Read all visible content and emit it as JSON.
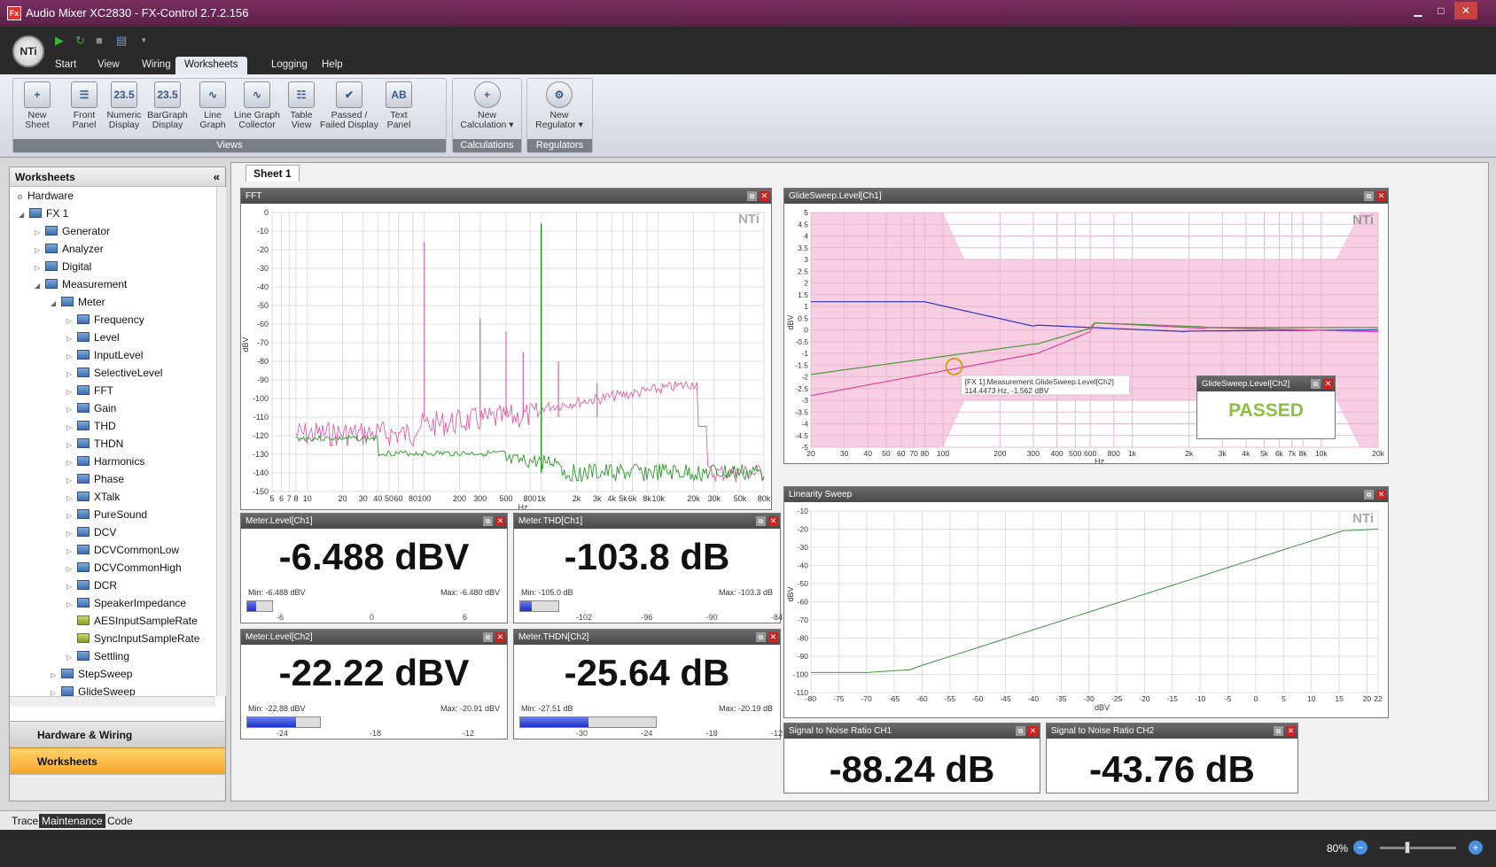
{
  "window": {
    "title": "Audio Mixer XC2830 - FX-Control 2.7.2.156",
    "icon": "Fx",
    "minimize": "▁",
    "maximize": "□",
    "close": "✕"
  },
  "logo": "NTi",
  "quick_access": [
    "play-icon",
    "refresh-icon",
    "stop-icon",
    "list-icon",
    "dropdown-icon"
  ],
  "menu_tabs": [
    {
      "label": "Start"
    },
    {
      "label": "View"
    },
    {
      "label": "Wiring"
    },
    {
      "label": "Worksheets",
      "active": true
    },
    {
      "label": "Logging"
    },
    {
      "label": "Help"
    }
  ],
  "ribbon": {
    "views": {
      "label": "Views",
      "buttons": [
        {
          "l1": "New",
          "l2": "Sheet",
          "icon": "new-sheet-icon",
          "glyph": "+"
        },
        {
          "l1": "Front",
          "l2": "Panel",
          "icon": "front-panel-icon",
          "glyph": "☰"
        },
        {
          "l1": "Numeric",
          "l2": "Display",
          "icon": "numeric-display-icon",
          "glyph": "23.5"
        },
        {
          "l1": "BarGraph",
          "l2": "Display",
          "icon": "bargraph-display-icon",
          "glyph": "23.5"
        },
        {
          "l1": "Line",
          "l2": "Graph",
          "icon": "line-graph-icon",
          "glyph": "∿"
        },
        {
          "l1": "Line Graph",
          "l2": "Collector",
          "icon": "line-graph-collector-icon",
          "glyph": "∿"
        },
        {
          "l1": "Table",
          "l2": "View",
          "icon": "table-view-icon",
          "glyph": "☷"
        },
        {
          "l1": "Passed /",
          "l2": "Failed Display",
          "icon": "passed-failed-icon",
          "glyph": "✔"
        },
        {
          "l1": "Text",
          "l2": "Panel",
          "icon": "text-panel-icon",
          "glyph": "AB"
        }
      ]
    },
    "calculations": {
      "label": "Calculations",
      "buttons": [
        {
          "l1": "New",
          "l2": "Calculation ▾",
          "icon": "new-calculation-icon",
          "glyph": "+"
        }
      ]
    },
    "regulators": {
      "label": "Regulators",
      "buttons": [
        {
          "l1": "New",
          "l2": "Regulator ▾",
          "icon": "new-regulator-icon",
          "glyph": "⚙"
        }
      ]
    }
  },
  "sidebar": {
    "title": "Worksheets",
    "collapse": "«",
    "tree": [
      {
        "label": "Hardware",
        "level": 0,
        "exp": "⊘"
      },
      {
        "label": "FX 1",
        "level": 1,
        "exp": "◢"
      },
      {
        "label": "Generator",
        "level": 2,
        "exp": "▷"
      },
      {
        "label": "Analyzer",
        "level": 2,
        "exp": "▷"
      },
      {
        "label": "Digital",
        "level": 2,
        "exp": "▷"
      },
      {
        "label": "Measurement",
        "level": 2,
        "exp": "◢"
      },
      {
        "label": "Meter",
        "level": 3,
        "exp": "◢"
      },
      {
        "label": "Frequency",
        "level": 4,
        "exp": "▷"
      },
      {
        "label": "Level",
        "level": 4,
        "exp": "▷"
      },
      {
        "label": "InputLevel",
        "level": 4,
        "exp": "▷"
      },
      {
        "label": "SelectiveLevel",
        "level": 4,
        "exp": "▷"
      },
      {
        "label": "FFT",
        "level": 4,
        "exp": "▷"
      },
      {
        "label": "Gain",
        "level": 4,
        "exp": "▷"
      },
      {
        "label": "THD",
        "level": 4,
        "exp": "▷"
      },
      {
        "label": "THDN",
        "level": 4,
        "exp": "▷"
      },
      {
        "label": "Harmonics",
        "level": 4,
        "exp": "▷"
      },
      {
        "label": "Phase",
        "level": 4,
        "exp": "▷"
      },
      {
        "label": "XTalk",
        "level": 4,
        "exp": "▷"
      },
      {
        "label": "PureSound",
        "level": 4,
        "exp": "▷"
      },
      {
        "label": "DCV",
        "level": 4,
        "exp": "▷"
      },
      {
        "label": "DCVCommonLow",
        "level": 4,
        "exp": "▷"
      },
      {
        "label": "DCVCommonHigh",
        "level": 4,
        "exp": "▷"
      },
      {
        "label": "DCR",
        "level": 4,
        "exp": "▷"
      },
      {
        "label": "SpeakerImpedance",
        "level": 4,
        "exp": "▷"
      },
      {
        "label": "AESInputSampleRate",
        "level": 4,
        "exp": "",
        "green": true
      },
      {
        "label": "SyncInputSampleRate",
        "level": 4,
        "exp": "",
        "green": true
      },
      {
        "label": "Settling",
        "level": 4,
        "exp": "▷"
      },
      {
        "label": "StepSweep",
        "level": 3,
        "exp": "▷"
      },
      {
        "label": "GlideSweep",
        "level": 3,
        "exp": "▷"
      }
    ],
    "nav": [
      "Hardware & Wiring",
      "Worksheets"
    ]
  },
  "sheet_tab": "Sheet 1",
  "watermark": "NTi",
  "fft": {
    "title": "FFT",
    "ylabel": "dBV",
    "xlabel": "Hz",
    "yticks": [
      "0",
      "-10",
      "-20",
      "-30",
      "-40",
      "-50",
      "-60",
      "-70",
      "-80",
      "-90",
      "-100",
      "-110",
      "-120",
      "-130",
      "-140",
      "-150"
    ],
    "xticks": [
      "5",
      "6",
      "7",
      "8",
      "10",
      "20",
      "30",
      "40",
      "50",
      "60",
      "80",
      "100",
      "200",
      "300",
      "500",
      "800",
      "1k",
      "2k",
      "3k",
      "4k",
      "5k",
      "6k",
      "8k",
      "10k",
      "20k",
      "30k",
      "50k",
      "80k"
    ],
    "series_colors": [
      "#e060a8",
      "#2a9a2a"
    ]
  },
  "glide": {
    "title": "GlideSweep.Level[Ch1]",
    "ylabel": "dBV",
    "xlabel": "Hz",
    "yticks": [
      "5",
      "4.5",
      "4",
      "3.5",
      "3",
      "2.5",
      "2",
      "1.5",
      "1",
      "0.5",
      "0",
      "-0.5",
      "-1",
      "-1.5",
      "-2",
      "-2.5",
      "-3",
      "-3.5",
      "-4",
      "-4.5",
      "-5"
    ],
    "xticks": [
      "20",
      "30",
      "40",
      "50",
      "60",
      "70",
      "80",
      "100",
      "200",
      "300",
      "400",
      "500",
      "600",
      "800",
      "1k",
      "2k",
      "3k",
      "4k",
      "5k",
      "6k",
      "7k",
      "8k",
      "10k",
      "20k"
    ],
    "tooltip1": "[FX 1].Measurement.GlideSweep.Level[Ch2]",
    "tooltip2": "114.4473 Hz, -1.562 dBV",
    "series_colors": [
      "#3030c0",
      "#e040a0",
      "#4a9a3a"
    ]
  },
  "passfail": {
    "title": "GlideSweep.Level[Ch2]",
    "value": "PASSED",
    "color": "#8ac040"
  },
  "linearity": {
    "title": "Linearity Sweep",
    "ylabel": "dBV",
    "xlabel": "dBV",
    "yticks": [
      "-10",
      "-20",
      "-30",
      "-40",
      "-50",
      "-60",
      "-70",
      "-80",
      "-90",
      "-100",
      "-110"
    ],
    "xticks": [
      "-80",
      "-75",
      "-70",
      "-65",
      "-60",
      "-55",
      "-50",
      "-45",
      "-40",
      "-35",
      "-30",
      "-25",
      "-20",
      "-15",
      "-10",
      "-5",
      "0",
      "5",
      "10",
      "15",
      "20",
      "22"
    ]
  },
  "meters": [
    {
      "title": "Meter.Level[Ch1]",
      "value": "-6.488 dBV",
      "min": "Min: -6.488 dBV",
      "max": "Max: -6.480 dBV",
      "ticks": [
        "-6",
        "0",
        "6"
      ],
      "fill": 0.35
    },
    {
      "title": "Meter.THD[Ch1]",
      "value": "-103.8 dB",
      "min": "Min: -105.0 dB",
      "max": "Max: -103.3 dB",
      "ticks": [
        "-102",
        "-96",
        "-90",
        "-84"
      ],
      "fill": 0.3
    },
    {
      "title": "Meter.Level[Ch2]",
      "value": "-22.22 dBV",
      "min": "Min: -22.88 dBV",
      "max": "Max: -20.91 dBV",
      "ticks": [
        "-24",
        "-18",
        "-12"
      ],
      "fill": 0.67
    },
    {
      "title": "Meter.THDN[Ch2]",
      "value": "-25.64 dB",
      "min": "Min: -27.51 dB",
      "max": "Max: -20.19 dB",
      "ticks": [
        "-30",
        "-24",
        "-18",
        "-12"
      ],
      "fill": 0.5
    }
  ],
  "snr": [
    {
      "title": "Signal to Noise Ratio CH1",
      "value": "-88.24 dB"
    },
    {
      "title": "Signal to Noise Ratio CH2",
      "value": "-43.76 dB"
    }
  ],
  "bottom_tabs": [
    {
      "label": "Trace"
    },
    {
      "label": "Maintenance",
      "active": true
    },
    {
      "label": "Code"
    }
  ],
  "zoom": "80%"
}
